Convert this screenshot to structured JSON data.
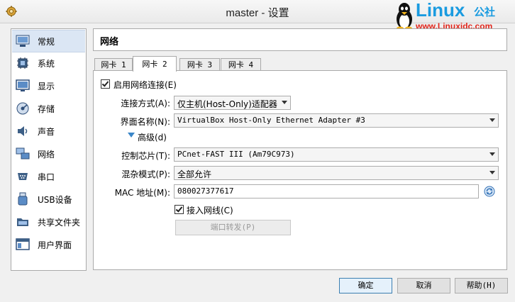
{
  "window": {
    "title": "master - 设置"
  },
  "watermark": {
    "brand": "Linux",
    "brand_cn": "公社",
    "url": "www.Linuxidc.com"
  },
  "sidebar": {
    "items": [
      {
        "label": "常规",
        "icon": "general-icon",
        "selected": true
      },
      {
        "label": "系统",
        "icon": "system-chip-icon"
      },
      {
        "label": "显示",
        "icon": "display-icon"
      },
      {
        "label": "存储",
        "icon": "storage-icon"
      },
      {
        "label": "声音",
        "icon": "audio-icon"
      },
      {
        "label": "网络",
        "icon": "network-icon"
      },
      {
        "label": "串口",
        "icon": "serial-port-icon"
      },
      {
        "label": "USB设备",
        "icon": "usb-icon"
      },
      {
        "label": "共享文件夹",
        "icon": "shared-folder-icon"
      },
      {
        "label": "用户界面",
        "icon": "user-interface-icon"
      }
    ]
  },
  "page": {
    "title": "网络"
  },
  "tabs": [
    {
      "label": "网卡 1"
    },
    {
      "label": "网卡 2",
      "active": true
    },
    {
      "label": "网卡 3"
    },
    {
      "label": "网卡 4"
    }
  ],
  "form": {
    "enable_label": "启用网络连接(E)",
    "enable_checked": true,
    "attach_label": "连接方式(A):",
    "attach_value": "仅主机(Host-Only)适配器",
    "name_label": "界面名称(N):",
    "name_value": "VirtualBox Host-Only Ethernet Adapter #3",
    "advanced_label": "高级(d)",
    "adapter_label": "控制芯片(T):",
    "adapter_value": "PCnet-FAST III (Am79C973)",
    "promisc_label": "混杂模式(P):",
    "promisc_value": "全部允许",
    "mac_label": "MAC 地址(M):",
    "mac_value": "080027377617",
    "cable_label": "接入网线(C)",
    "cable_checked": true,
    "port_forward_label": "端口转发(P)"
  },
  "buttons": {
    "ok": "确定",
    "cancel": "取消",
    "help": "帮助(H)"
  },
  "colors": {
    "accent": "#3c7fb1",
    "brand_blue": "#1a9be0",
    "brand_red": "#e0261c"
  }
}
